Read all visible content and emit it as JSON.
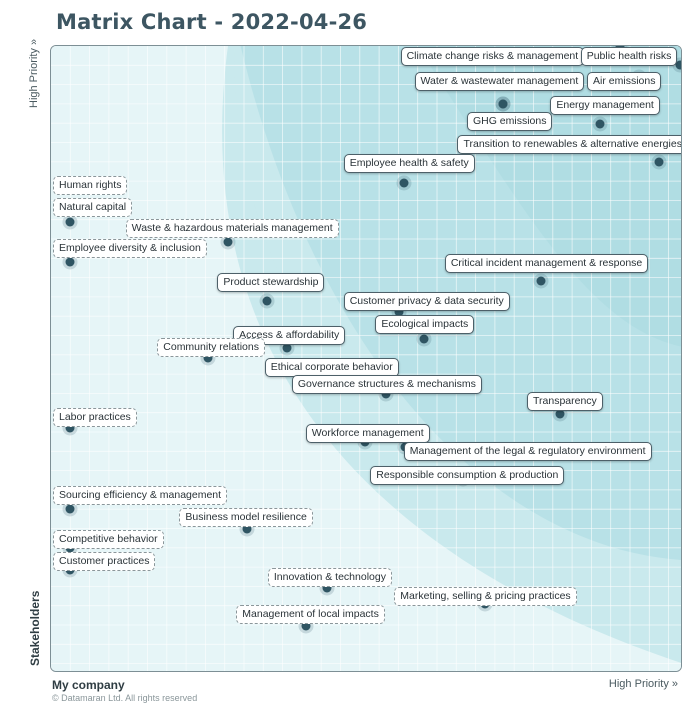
{
  "chart_data": {
    "type": "scatter",
    "title": "Matrix Chart - 2022-04-26",
    "xlabel_low": "My company",
    "xlabel_high": "High Priority »",
    "ylabel_low": "Stakeholders",
    "ylabel_high": "High Priority »",
    "xlim": [
      0,
      1
    ],
    "ylim": [
      0,
      1
    ],
    "grid": true,
    "bands": [
      "low",
      "medium",
      "high"
    ],
    "colors": {
      "band_low": "#e6f5f7",
      "band_mid": "#c9e9ed",
      "band_high": "#aadbe1",
      "grid": "#ffffff",
      "dot": "#2f5563",
      "title": "#3d5662"
    },
    "points": [
      {
        "label": "Climate change risks & management",
        "x": 0.9,
        "y": 1.0,
        "dashed": false,
        "lx": 0.55,
        "ly": 0.985
      },
      {
        "label": "Public health risks",
        "x": 0.995,
        "y": 0.97,
        "dashed": false,
        "lx": 0.835,
        "ly": 0.985
      },
      {
        "label": "Water & wastewater management",
        "x": 0.715,
        "y": 0.907,
        "dashed": false,
        "lx": 0.572,
        "ly": 0.945
      },
      {
        "label": "Air emissions",
        "x": 0.93,
        "y": 0.95,
        "dashed": false,
        "lx": 0.845,
        "ly": 0.945
      },
      {
        "label": "Energy management",
        "x": 0.869,
        "y": 0.876,
        "dashed": false,
        "lx": 0.787,
        "ly": 0.907
      },
      {
        "label": "GHG emissions",
        "x": 0.715,
        "y": 0.907,
        "dashed": false,
        "lx": 0.655,
        "ly": 0.882
      },
      {
        "label": "Transition to renewables & alternative energies",
        "x": 0.962,
        "y": 0.815,
        "dashed": false,
        "lx": 0.64,
        "ly": 0.845
      },
      {
        "label": "Employee health & safety",
        "x": 0.558,
        "y": 0.781,
        "dashed": false,
        "lx": 0.46,
        "ly": 0.815
      },
      {
        "label": "Human rights",
        "x": 0.03,
        "y": 0.74,
        "dashed": true,
        "lx": 0.0,
        "ly": 0.78
      },
      {
        "label": "Natural capital",
        "x": 0.03,
        "y": 0.72,
        "dashed": true,
        "lx": 0.0,
        "ly": 0.745
      },
      {
        "label": "Waste & hazardous materials management",
        "x": 0.28,
        "y": 0.687,
        "dashed": true,
        "lx": 0.115,
        "ly": 0.712
      },
      {
        "label": "Employee diversity & inclusion",
        "x": 0.03,
        "y": 0.655,
        "dashed": true,
        "lx": 0.0,
        "ly": 0.68
      },
      {
        "label": "Critical incident management & response",
        "x": 0.776,
        "y": 0.625,
        "dashed": false,
        "lx": 0.62,
        "ly": 0.655
      },
      {
        "label": "Product stewardship",
        "x": 0.342,
        "y": 0.594,
        "dashed": false,
        "lx": 0.26,
        "ly": 0.625
      },
      {
        "label": "Customer privacy & data security",
        "x": 0.55,
        "y": 0.575,
        "dashed": false,
        "lx": 0.46,
        "ly": 0.595
      },
      {
        "label": "Ecological impacts",
        "x": 0.59,
        "y": 0.532,
        "dashed": false,
        "lx": 0.51,
        "ly": 0.558
      },
      {
        "label": "Access & affordability",
        "x": 0.374,
        "y": 0.518,
        "dashed": false,
        "lx": 0.285,
        "ly": 0.54
      },
      {
        "label": "Community relations",
        "x": 0.248,
        "y": 0.502,
        "dashed": true,
        "lx": 0.165,
        "ly": 0.522
      },
      {
        "label": "Ethical corporate behavior",
        "x": 0.425,
        "y": 0.475,
        "dashed": false,
        "lx": 0.335,
        "ly": 0.49
      },
      {
        "label": "Governance structures & mechanisms",
        "x": 0.53,
        "y": 0.445,
        "dashed": false,
        "lx": 0.378,
        "ly": 0.462
      },
      {
        "label": "Transparency",
        "x": 0.805,
        "y": 0.413,
        "dashed": false,
        "lx": 0.75,
        "ly": 0.435
      },
      {
        "label": "Labor practices",
        "x": 0.03,
        "y": 0.39,
        "dashed": true,
        "lx": 0.0,
        "ly": 0.41
      },
      {
        "label": "Workforce management",
        "x": 0.497,
        "y": 0.368,
        "dashed": false,
        "lx": 0.4,
        "ly": 0.385
      },
      {
        "label": "Management of the legal & regulatory environment",
        "x": 0.56,
        "y": 0.36,
        "dashed": false,
        "lx": 0.555,
        "ly": 0.356
      },
      {
        "label": "Responsible consumption & production",
        "x": 0.652,
        "y": 0.31,
        "dashed": false,
        "lx": 0.502,
        "ly": 0.318
      },
      {
        "label": "Sourcing efficiency & management",
        "x": 0.03,
        "y": 0.261,
        "dashed": true,
        "lx": 0.0,
        "ly": 0.285
      },
      {
        "label": "Business model resilience",
        "x": 0.31,
        "y": 0.23,
        "dashed": true,
        "lx": 0.2,
        "ly": 0.25
      },
      {
        "label": "Competitive behavior",
        "x": 0.03,
        "y": 0.2,
        "dashed": true,
        "lx": 0.0,
        "ly": 0.215
      },
      {
        "label": "Customer practices",
        "x": 0.03,
        "y": 0.165,
        "dashed": true,
        "lx": 0.0,
        "ly": 0.18
      },
      {
        "label": "Innovation & technology",
        "x": 0.437,
        "y": 0.135,
        "dashed": true,
        "lx": 0.34,
        "ly": 0.155
      },
      {
        "label": "Marketing, selling & pricing practices",
        "x": 0.686,
        "y": 0.11,
        "dashed": true,
        "lx": 0.54,
        "ly": 0.125
      },
      {
        "label": "Management of local impacts",
        "x": 0.403,
        "y": 0.075,
        "dashed": true,
        "lx": 0.29,
        "ly": 0.095
      }
    ]
  },
  "footer": {
    "copyright": "© Datamaran Ltd. All rights reserved"
  }
}
